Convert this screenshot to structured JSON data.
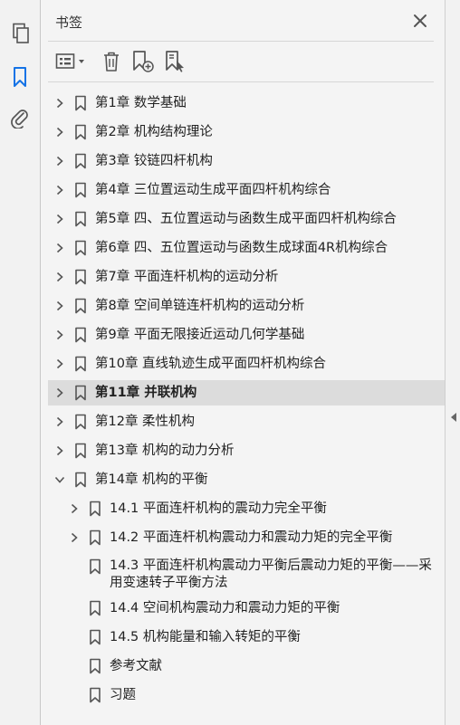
{
  "panel": {
    "title": "书签"
  },
  "rail": {
    "icons": [
      "pages-icon",
      "bookmark-icon",
      "attachment-icon"
    ]
  },
  "toolbar": {
    "buttons": [
      "options-menu-icon",
      "delete-icon",
      "new-bookmark-icon",
      "bookmark-from-selection-icon"
    ]
  },
  "colors": {
    "accent": "#1473e6",
    "selected_row": "#dcdcdc",
    "text": "#222222"
  },
  "bookmarks": [
    {
      "label": "第1章 数学基础",
      "level": 0,
      "expander": "collapsed"
    },
    {
      "label": "第2章 机构结构理论",
      "level": 0,
      "expander": "collapsed"
    },
    {
      "label": "第3章 铰链四杆机构",
      "level": 0,
      "expander": "collapsed"
    },
    {
      "label": "第4章 三位置运动生成平面四杆机构综合",
      "level": 0,
      "expander": "collapsed"
    },
    {
      "label": "第5章 四、五位置运动与函数生成平面四杆机构综合",
      "level": 0,
      "expander": "collapsed"
    },
    {
      "label": "第6章 四、五位置运动与函数生成球面4R机构综合",
      "level": 0,
      "expander": "collapsed"
    },
    {
      "label": "第7章 平面连杆机构的运动分析",
      "level": 0,
      "expander": "collapsed"
    },
    {
      "label": "第8章 空间单链连杆机构的运动分析",
      "level": 0,
      "expander": "collapsed"
    },
    {
      "label": "第9章 平面无限接近运动几何学基础",
      "level": 0,
      "expander": "collapsed"
    },
    {
      "label": "第10章 直线轨迹生成平面四杆机构综合",
      "level": 0,
      "expander": "collapsed"
    },
    {
      "label": "第11章 并联机构",
      "level": 0,
      "expander": "collapsed",
      "selected": true
    },
    {
      "label": "第12章 柔性机构",
      "level": 0,
      "expander": "collapsed"
    },
    {
      "label": "第13章 机构的动力分析",
      "level": 0,
      "expander": "collapsed"
    },
    {
      "label": "第14章 机构的平衡",
      "level": 0,
      "expander": "expanded"
    },
    {
      "label": "14.1 平面连杆机构的震动力完全平衡",
      "level": 1,
      "expander": "collapsed"
    },
    {
      "label": "14.2 平面连杆机构震动力和震动力矩的完全平衡",
      "level": 1,
      "expander": "collapsed"
    },
    {
      "label": "14.3 平面连杆机构震动力平衡后震动力矩的平衡——采用变速转子平衡方法",
      "level": 1,
      "expander": "none",
      "wrap": true
    },
    {
      "label": "14.4 空间机构震动力和震动力矩的平衡",
      "level": 1,
      "expander": "none"
    },
    {
      "label": "14.5 机构能量和输入转矩的平衡",
      "level": 1,
      "expander": "none"
    },
    {
      "label": "参考文献",
      "level": 1,
      "expander": "none"
    },
    {
      "label": "习题",
      "level": 1,
      "expander": "none"
    }
  ]
}
